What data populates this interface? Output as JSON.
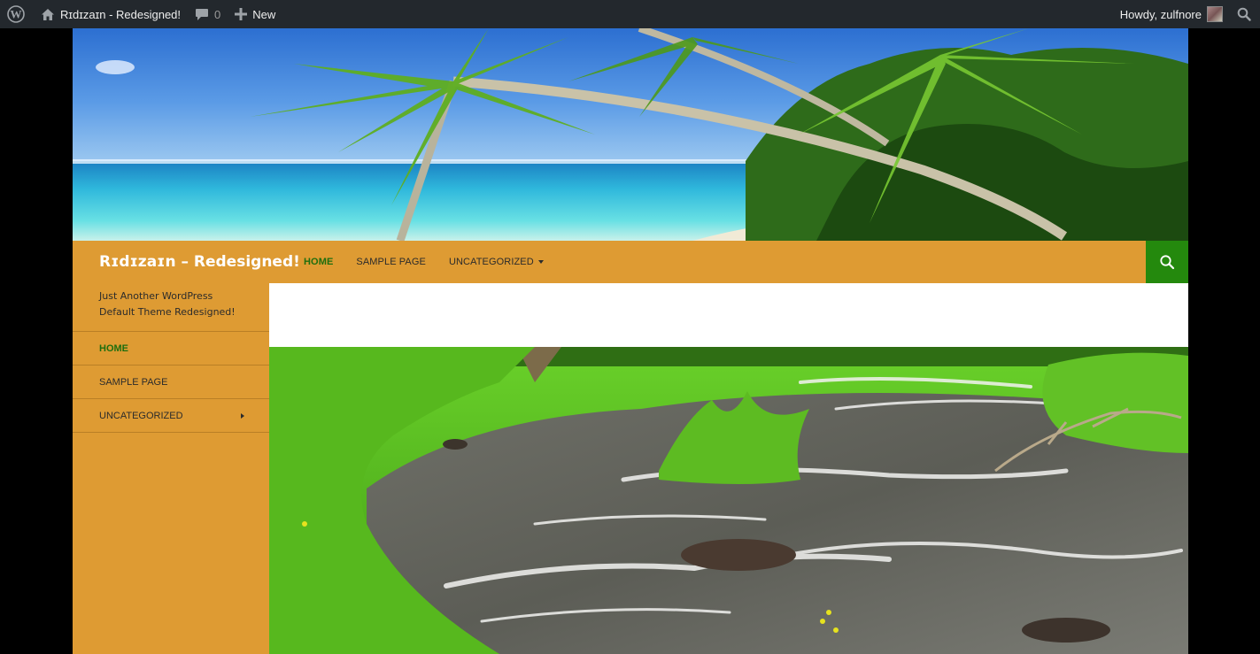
{
  "adminbar": {
    "wp_logo_icon": "wordpress-icon",
    "site_name": "Rɪdɪzaɪn - Redesigned!",
    "comments_count": "0",
    "new_label": "New",
    "greeting": "Howdy, zulfnore"
  },
  "site": {
    "title": "Rɪdɪzaɪn – Redesigned!",
    "tagline": "Just Another WordPress Default Theme Redesigned!"
  },
  "primary_nav": [
    {
      "label": "HOME",
      "current": true
    },
    {
      "label": "SAMPLE PAGE",
      "current": false
    },
    {
      "label": "UNCATEGORIZED",
      "current": false,
      "has_children": true
    }
  ],
  "sidebar_nav": [
    {
      "label": "HOME",
      "current": true
    },
    {
      "label": "SAMPLE PAGE",
      "current": false
    },
    {
      "label": "UNCATEGORIZED",
      "current": false,
      "has_children": true
    }
  ],
  "images": {
    "header": "tropical-beach-palms",
    "featured": "river-with-green-grass"
  },
  "colors": {
    "adminbar_bg": "#23282d",
    "site_accent": "#de9b33",
    "search_bg": "#24890d",
    "current_link": "#1f6e0e"
  }
}
